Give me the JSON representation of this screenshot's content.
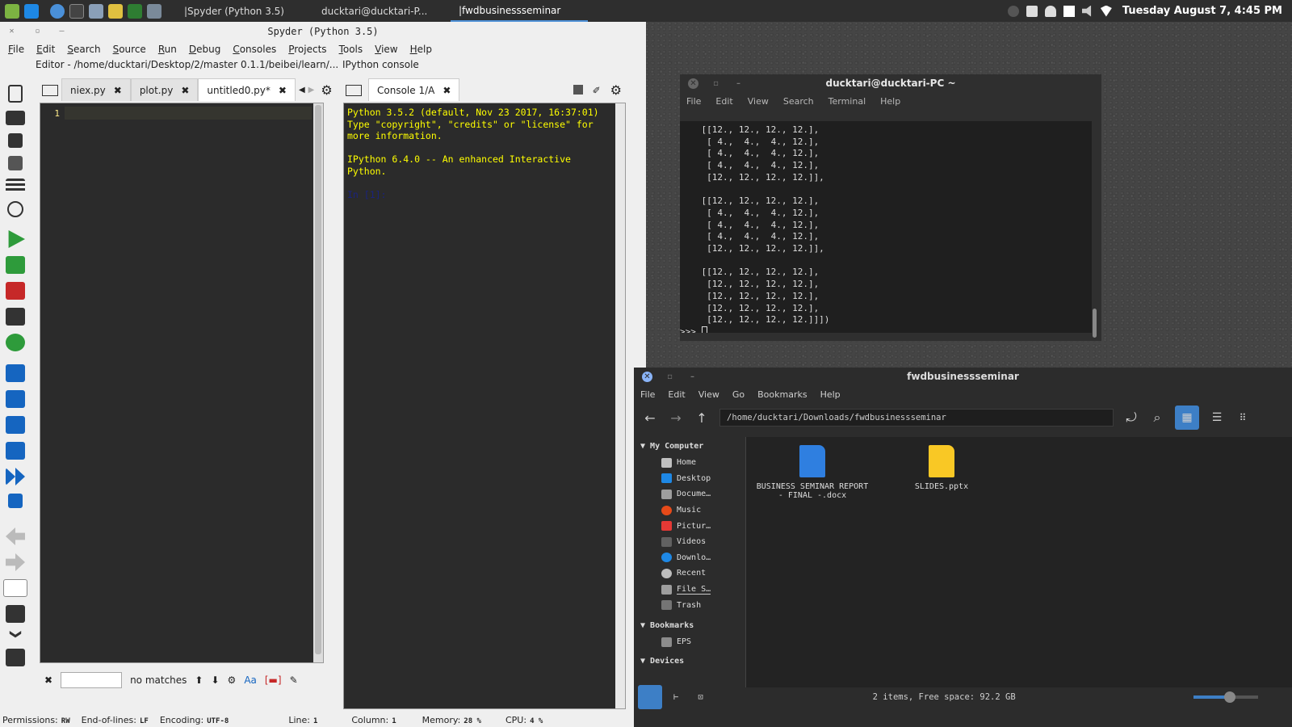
{
  "panel": {
    "tasks": [
      "|Spyder (Python 3.5)",
      "ducktari@ducktari-P...",
      "|fwdbusinessseminar"
    ],
    "clock": "Tuesday August  7,  4:45 PM"
  },
  "spyder": {
    "title": "Spyder (Python 3.5)",
    "menu": [
      "File",
      "Edit",
      "Search",
      "Source",
      "Run",
      "Debug",
      "Consoles",
      "Projects",
      "Tools",
      "View",
      "Help"
    ],
    "editor_title": "Editor - /home/ducktari/Desktop/2/master 0.1.1/beibei/learn/...",
    "tabs": [
      "niex.py",
      "plot.py",
      "untitled0.py*"
    ],
    "line_no": "1",
    "find": {
      "no_matches": "no matches",
      "case": "Aa"
    },
    "console_title": "IPython console",
    "console_tab": "Console 1/A",
    "console_lines": [
      "Python 3.5.2 (default, Nov 23 2017, 16:37:01)",
      "Type \"copyright\", \"credits\" or \"license\" for",
      "more information.",
      "",
      "IPython 6.4.0 -- An enhanced Interactive",
      "Python.",
      "",
      "In [1]:"
    ],
    "status": {
      "perm_label": "Permissions:",
      "perm": "RW",
      "eol_label": "End-of-lines:",
      "eol": "LF",
      "enc_label": "Encoding:",
      "enc": "UTF-8",
      "line_label": "Line:",
      "line": "1",
      "col_label": "Column:",
      "col": "1",
      "mem_label": "Memory:",
      "mem": "28 %",
      "cpu_label": "CPU:",
      "cpu": "4 %"
    }
  },
  "terminal": {
    "title": "ducktari@ducktari-PC ~",
    "menu": [
      "File",
      "Edit",
      "View",
      "Search",
      "Terminal",
      "Help"
    ],
    "output": "    [[12., 12., 12., 12.],\n     [ 4.,  4.,  4., 12.],\n     [ 4.,  4.,  4., 12.],\n     [ 4.,  4.,  4., 12.],\n     [12., 12., 12., 12.]],\n\n    [[12., 12., 12., 12.],\n     [ 4.,  4.,  4., 12.],\n     [ 4.,  4.,  4., 12.],\n     [ 4.,  4.,  4., 12.],\n     [12., 12., 12., 12.]],\n\n    [[12., 12., 12., 12.],\n     [12., 12., 12., 12.],\n     [12., 12., 12., 12.],\n     [12., 12., 12., 12.],\n     [12., 12., 12., 12.]]])",
    "prompt": ">>> "
  },
  "files": {
    "title": "fwdbusinessseminar",
    "menu": [
      "File",
      "Edit",
      "View",
      "Go",
      "Bookmarks",
      "Help"
    ],
    "path": "/home/ducktari/Downloads/fwdbusinessseminar",
    "sections": {
      "computer": "My Computer",
      "bookmarks": "Bookmarks",
      "devices": "Devices"
    },
    "places": [
      "Home",
      "Desktop",
      "Docume…",
      "Music",
      "Pictur…",
      "Videos",
      "Downlo…",
      "Recent",
      "File S…",
      "Trash"
    ],
    "bookmarks": [
      "EPS"
    ],
    "items": [
      "BUSINESS SEMINAR REPORT - FINAL -.docx",
      "SLIDES.pptx"
    ],
    "status": "2 items, Free space: 92.2 GB"
  }
}
